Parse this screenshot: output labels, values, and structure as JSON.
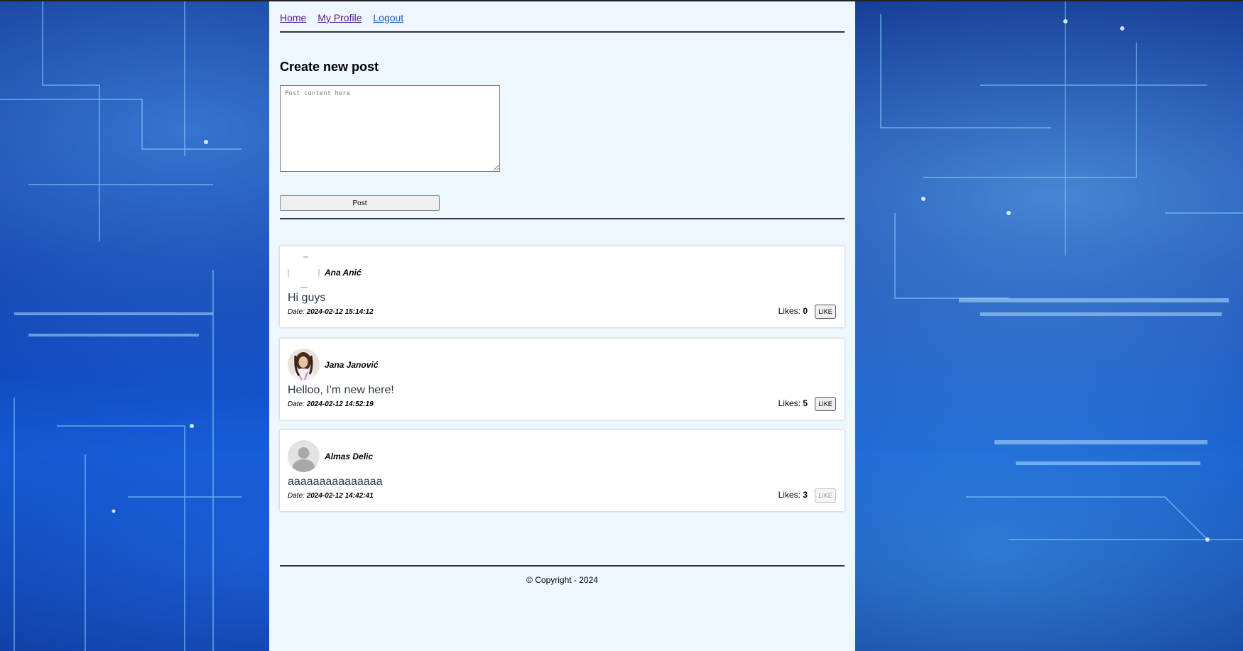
{
  "nav": {
    "home": "Home",
    "profile": "My Profile",
    "logout": "Logout"
  },
  "create": {
    "heading": "Create new post",
    "placeholder": "Post content here",
    "button": "Post"
  },
  "posts": [
    {
      "author": "Ana Anić",
      "content": "Hi guys",
      "date_label": "Date:",
      "date": "2024-02-12 15:14:12",
      "likes_label": "Likes:",
      "likes": "0",
      "like_button": "LIKE",
      "like_enabled": true,
      "avatar": "broken-image"
    },
    {
      "author": "Jana Janović",
      "content": "Helloo, I'm new here!",
      "date_label": "Date:",
      "date": "2024-02-12 14:52:19",
      "likes_label": "Likes:",
      "likes": "5",
      "like_button": "LIKE",
      "like_enabled": true,
      "avatar": "user-photo"
    },
    {
      "author": "Almas Delic",
      "content": "aaaaaaaaaaaaaaa",
      "date_label": "Date:",
      "date": "2024-02-12 14:42:41",
      "likes_label": "Likes:",
      "likes": "3",
      "like_button": "LIKE",
      "like_enabled": false,
      "avatar": "default-user-icon"
    }
  ],
  "footer": {
    "text": "© Copyright - 2024"
  },
  "colors": {
    "page_bg": "#eef6ff",
    "link_visited": "#551a8b",
    "link": "#1a5bc4",
    "background": "#0b3aa8"
  }
}
